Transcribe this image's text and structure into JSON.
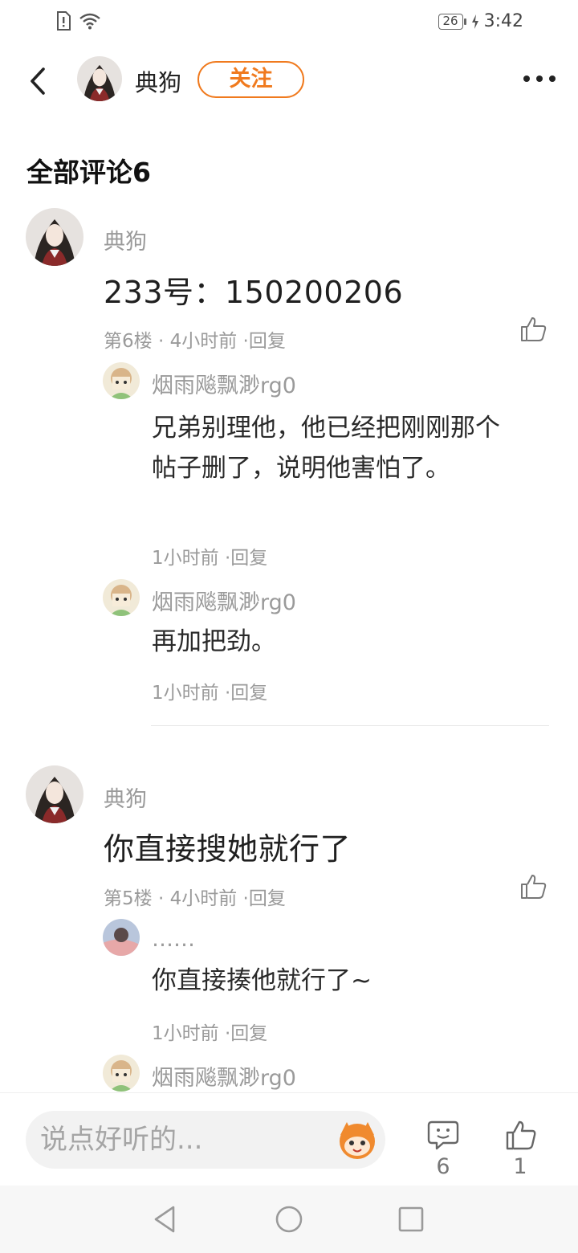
{
  "status": {
    "battery": "26",
    "time": "3:42"
  },
  "header": {
    "name": "典狗",
    "follow_label": "关注"
  },
  "section_title": "全部评论6",
  "comments": [
    {
      "author": "典狗",
      "text": "233号：150200206",
      "meta_floor": "第6楼 · 4小时前 ·",
      "reply_label": "回复",
      "replies": [
        {
          "author": "烟雨飚飘渺rg0",
          "text": " 兄弟别理他，他已经把刚刚那个帖子删了，说明他害怕了。",
          "time": "1小时前 ·",
          "reply_label": "回复"
        },
        {
          "author": "烟雨飚飘渺rg0",
          "text": "再加把劲。",
          "time": "1小时前 ·",
          "reply_label": "回复"
        }
      ]
    },
    {
      "author": "典狗",
      "text": "你直接搜她就行了",
      "meta_floor": "第5楼 · 4小时前 ·",
      "reply_label": "回复",
      "replies": [
        {
          "author": "……",
          "text": "你直接揍他就行了~",
          "time": "1小时前 ·",
          "reply_label": "回复"
        },
        {
          "author": "烟雨飚飘渺rg0"
        }
      ]
    }
  ],
  "bottom_bar": {
    "input_placeholder": "说点好听的...",
    "comment_count": "6",
    "like_count": "1"
  },
  "colors": {
    "accent": "#f07a1e",
    "meta_gray": "#9a9a9a"
  }
}
